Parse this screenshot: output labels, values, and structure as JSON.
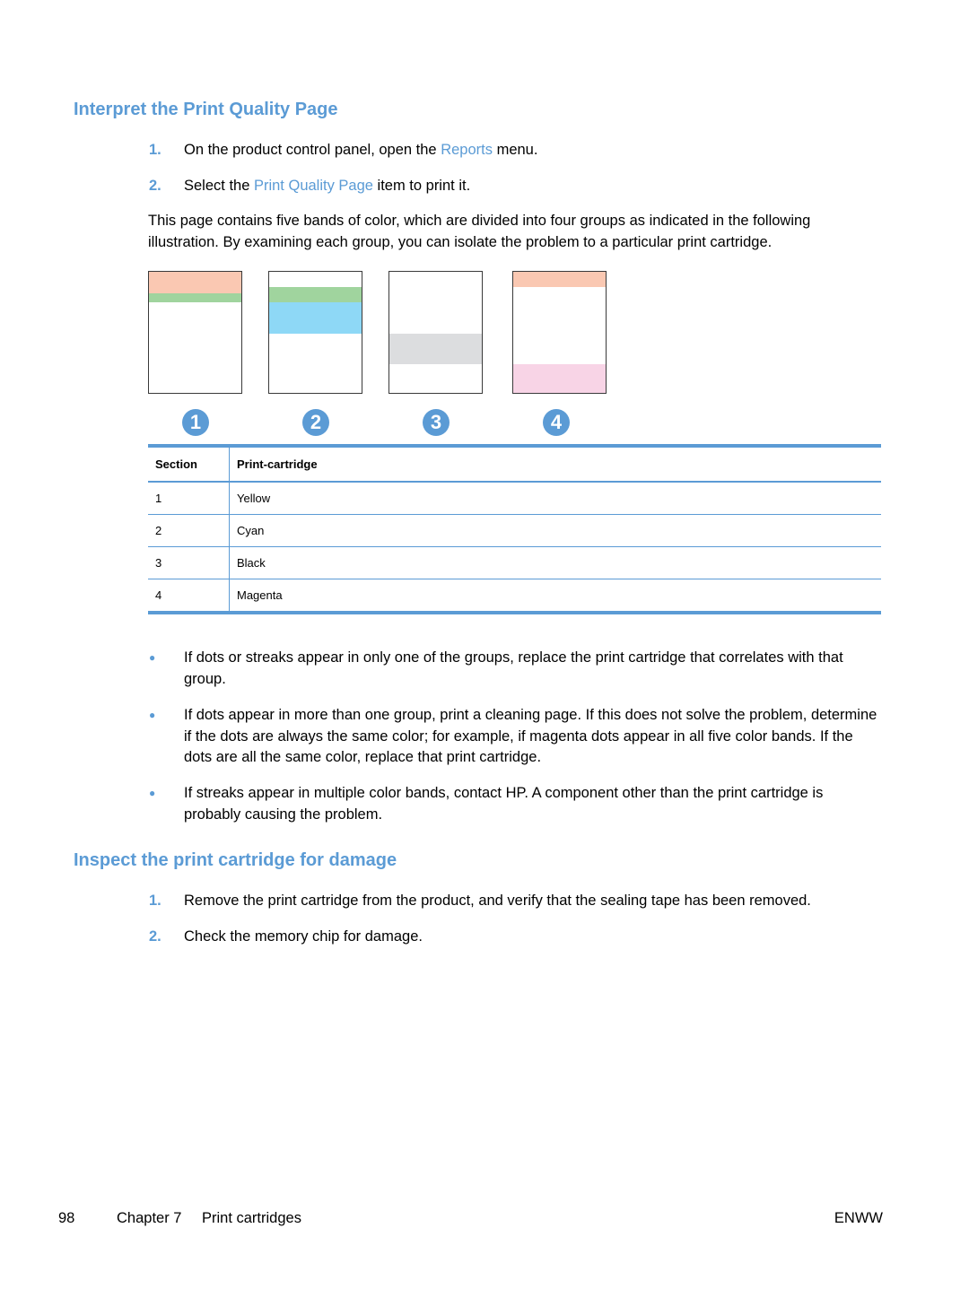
{
  "section1": {
    "heading": "Interpret the Print Quality Page",
    "steps": [
      {
        "num": "1.",
        "before": "On the product control panel, open the ",
        "link": "Reports",
        "after": " menu."
      },
      {
        "num": "2.",
        "before": "Select the ",
        "link": "Print Quality Page",
        "after": " item to print it."
      }
    ],
    "paragraph": "This page contains five bands of color, which are divided into four groups as indicated in the following illustration. By examining each group, you can isolate the problem to a particular print cartridge.",
    "illustration": {
      "callouts": [
        "1",
        "2",
        "3",
        "4"
      ],
      "colors": {
        "orange": "#fac8b2",
        "green": "#a0d49e",
        "cyan": "#8ed8f6",
        "gray": "#dcdddf",
        "pink": "#f8d4e6"
      }
    },
    "table": {
      "headers": [
        "Section",
        "Print-cartridge"
      ],
      "rows": [
        [
          "1",
          "Yellow"
        ],
        [
          "2",
          "Cyan"
        ],
        [
          "3",
          "Black"
        ],
        [
          "4",
          "Magenta"
        ]
      ]
    },
    "bullets": [
      "If dots or streaks appear in only one of the groups, replace the print cartridge that correlates with that group.",
      "If dots appear in more than one group, print a cleaning page. If this does not solve the problem, determine if the dots are always the same color; for example, if magenta dots appear in all five color bands. If the dots are all the same color, replace that print cartridge.",
      "If streaks appear in multiple color bands, contact HP. A component other than the print cartridge is probably causing the problem."
    ]
  },
  "section2": {
    "heading": "Inspect the print cartridge for damage",
    "steps": [
      {
        "num": "1.",
        "text": "Remove the print cartridge from the product, and verify that the sealing tape has been removed."
      },
      {
        "num": "2.",
        "text": "Check the memory chip for damage."
      }
    ]
  },
  "footer": {
    "page_number": "98",
    "chapter": "Chapter 7",
    "chapter_title": "Print cartridges",
    "right": "ENWW"
  },
  "bullet_glyph": "●"
}
